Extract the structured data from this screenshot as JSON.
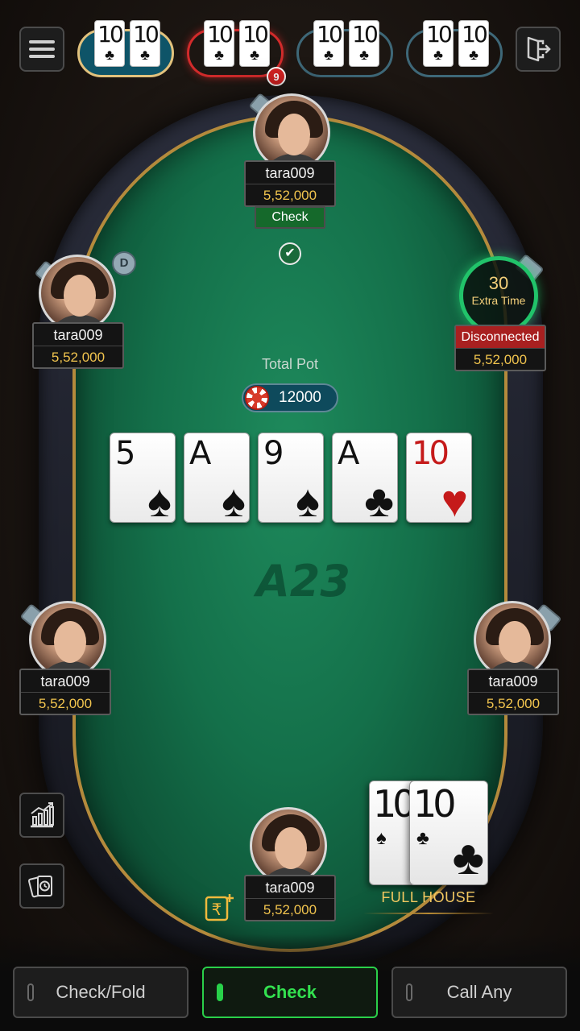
{
  "top_bar": {
    "menu_icon": "hamburger-menu-icon",
    "exit_icon": "exit-door-icon",
    "tables": [
      {
        "cards": [
          {
            "rank": "10",
            "suit": "♣"
          },
          {
            "rank": "10",
            "suit": "♣"
          }
        ],
        "state": "active"
      },
      {
        "cards": [
          {
            "rank": "10",
            "suit": "♣"
          },
          {
            "rank": "10",
            "suit": "♣"
          }
        ],
        "state": "alert",
        "badge": "9"
      },
      {
        "cards": [
          {
            "rank": "10",
            "suit": "♣"
          },
          {
            "rank": "10",
            "suit": "♣"
          }
        ],
        "state": "idle"
      },
      {
        "cards": [
          {
            "rank": "10",
            "suit": "♣"
          },
          {
            "rank": "10",
            "suit": "♣"
          }
        ],
        "state": "idle"
      }
    ]
  },
  "players": {
    "top": {
      "name": "tara009",
      "chips": "5,52,000",
      "action": "Check"
    },
    "upper_left": {
      "name": "tara009",
      "chips": "5,52,000",
      "dealer": "D"
    },
    "upper_right": {
      "name": "Disconnected",
      "chips": "5,52,000",
      "timer": "30",
      "timer_label": "Extra Time"
    },
    "lower_left": {
      "name": "tara009",
      "chips": "5,52,000"
    },
    "lower_right": {
      "name": "tara009",
      "chips": "5,52,000"
    },
    "hero": {
      "name": "tara009",
      "chips": "5,52,000"
    }
  },
  "pot": {
    "label": "Total Pot",
    "value": "12000"
  },
  "community_cards": [
    {
      "rank": "5",
      "suit": "♠",
      "color": "black"
    },
    {
      "rank": "A",
      "suit": "♠",
      "color": "black"
    },
    {
      "rank": "9",
      "suit": "♠",
      "color": "black"
    },
    {
      "rank": "A",
      "suit": "♣",
      "color": "black"
    },
    {
      "rank": "10",
      "suit": "♥",
      "color": "red"
    }
  ],
  "hero_hand": {
    "cards": [
      {
        "rank": "10",
        "suit": "♠"
      },
      {
        "rank": "10",
        "suit": "♣"
      }
    ],
    "hand_name": "FULL HOUSE"
  },
  "brand": "A23",
  "side_buttons": [
    "stats-chart-icon",
    "hand-history-icon"
  ],
  "add_cash_icon": "rupee-add-icon",
  "actions": {
    "check_fold": "Check/Fold",
    "check": "Check",
    "call_any": "Call Any",
    "selected": "check"
  },
  "colors": {
    "felt": "#14704a",
    "accent_gold": "#f1c44e",
    "selected_green": "#33e04f",
    "alert_red": "#d42222"
  }
}
